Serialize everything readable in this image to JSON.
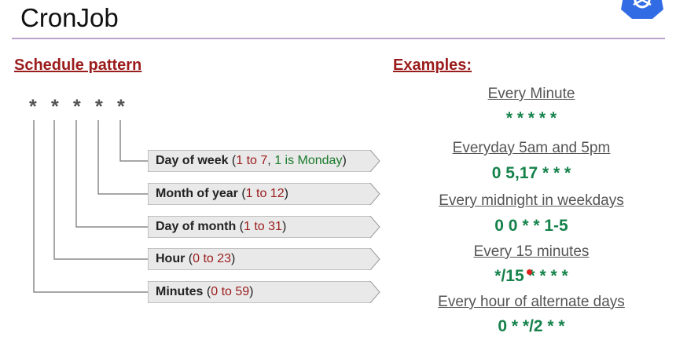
{
  "title": "CronJob",
  "left_heading": "Schedule pattern",
  "right_heading": "Examples:",
  "stars": [
    "*",
    "*",
    "*",
    "*",
    "*"
  ],
  "fields": [
    {
      "name": "Day of week",
      "open": " (",
      "range": "1 to 7",
      "sep": ", ",
      "note": "1 is Monday",
      "close": ")"
    },
    {
      "name": "Month of year",
      "open": " (",
      "range": "1 to 12",
      "close": ")"
    },
    {
      "name": "Day of month",
      "open": " (",
      "range": "1 to 31",
      "close": ")"
    },
    {
      "name": "Hour",
      "open": " (",
      "range": "0 to 23",
      "close": ")"
    },
    {
      "name": "Minutes",
      "open": " (",
      "range": "0 to 59",
      "close": ")"
    }
  ],
  "examples": [
    {
      "title": "Every Minute",
      "expr": "* * * * *"
    },
    {
      "title": "Everyday 5am and 5pm",
      "expr": "0 5,17 * * *"
    },
    {
      "title": "Every midnight in weekdays",
      "expr": "0 0 * * 1-5"
    },
    {
      "title": "Every 15 minutes",
      "expr": "*/15 * * * *"
    },
    {
      "title": "Every hour of alternate days",
      "expr": "0 * */2 * *"
    }
  ],
  "colors": {
    "heading": "#9b1c1c",
    "range": "#9b1c1c",
    "note": "#1a7a2a",
    "expr": "#14824a",
    "rule": "#b8a3cc",
    "logo": "#326ce5"
  }
}
